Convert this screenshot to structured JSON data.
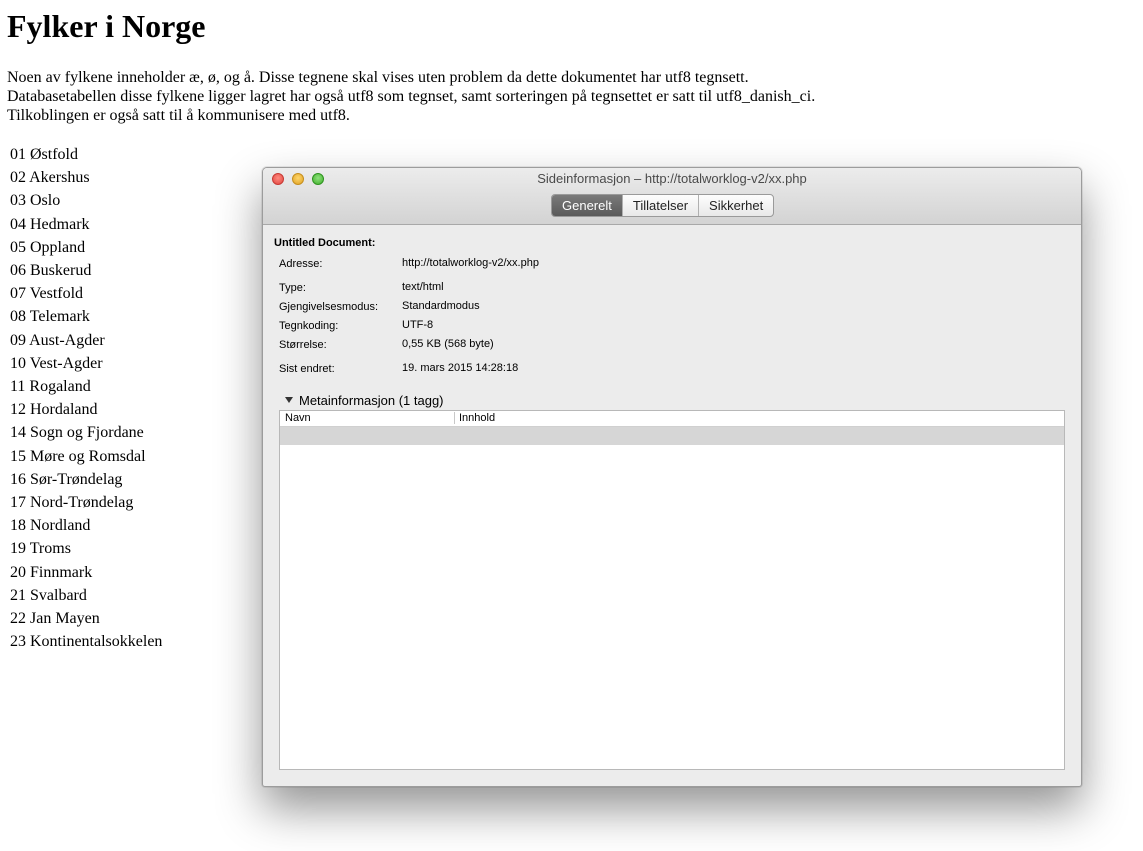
{
  "page": {
    "heading": "Fylker i Norge",
    "intro_lines": [
      "Noen av fylkene inneholder æ, ø, og å. Disse tegnene skal vises uten problem da dette dokumentet har utf8 tegnsett.",
      "Databasetabellen disse fylkene ligger lagret har også utf8 som tegnset, samt sorteringen på tegnsettet er satt til utf8_danish_ci.",
      "Tilkoblingen er også satt til å kommunisere med utf8."
    ],
    "counties": [
      "01 Østfold",
      "02 Akershus",
      "03 Oslo",
      "04 Hedmark",
      "05 Oppland",
      "06 Buskerud",
      "07 Vestfold",
      "08 Telemark",
      "09 Aust-Agder",
      "10 Vest-Agder",
      "11 Rogaland",
      "12 Hordaland",
      "14 Sogn og Fjordane",
      "15 Møre og Romsdal",
      "16 Sør-Trøndelag",
      "17 Nord-Trøndelag",
      "18 Nordland",
      "19 Troms",
      "20 Finnmark",
      "21 Svalbard",
      "22 Jan Mayen",
      "23 Kontinentalsokkelen"
    ]
  },
  "window": {
    "title": "Sideinformasjon – http://totalworklog-v2/xx.php",
    "tabs": [
      "Generelt",
      "Tillatelser",
      "Sikkerhet"
    ],
    "active_tab": "Generelt",
    "doc_title": "Untitled Document:",
    "fields": {
      "address": {
        "label": "Adresse:",
        "value": "http://totalworklog-v2/xx.php"
      },
      "type": {
        "label": "Type:",
        "value": "text/html"
      },
      "render_mode": {
        "label": "Gjengivelsesmodus:",
        "value": "Standardmodus"
      },
      "encoding": {
        "label": "Tegnkoding:",
        "value": "UTF-8"
      },
      "size": {
        "label": "Størrelse:",
        "value": "0,55 KB (568 byte)"
      },
      "modified": {
        "label": "Sist endret:",
        "value": "19. mars 2015 14:28:18"
      }
    },
    "meta": {
      "header": "Metainformasjon (1 tagg)",
      "columns": [
        "Navn",
        "Innhold"
      ]
    }
  }
}
